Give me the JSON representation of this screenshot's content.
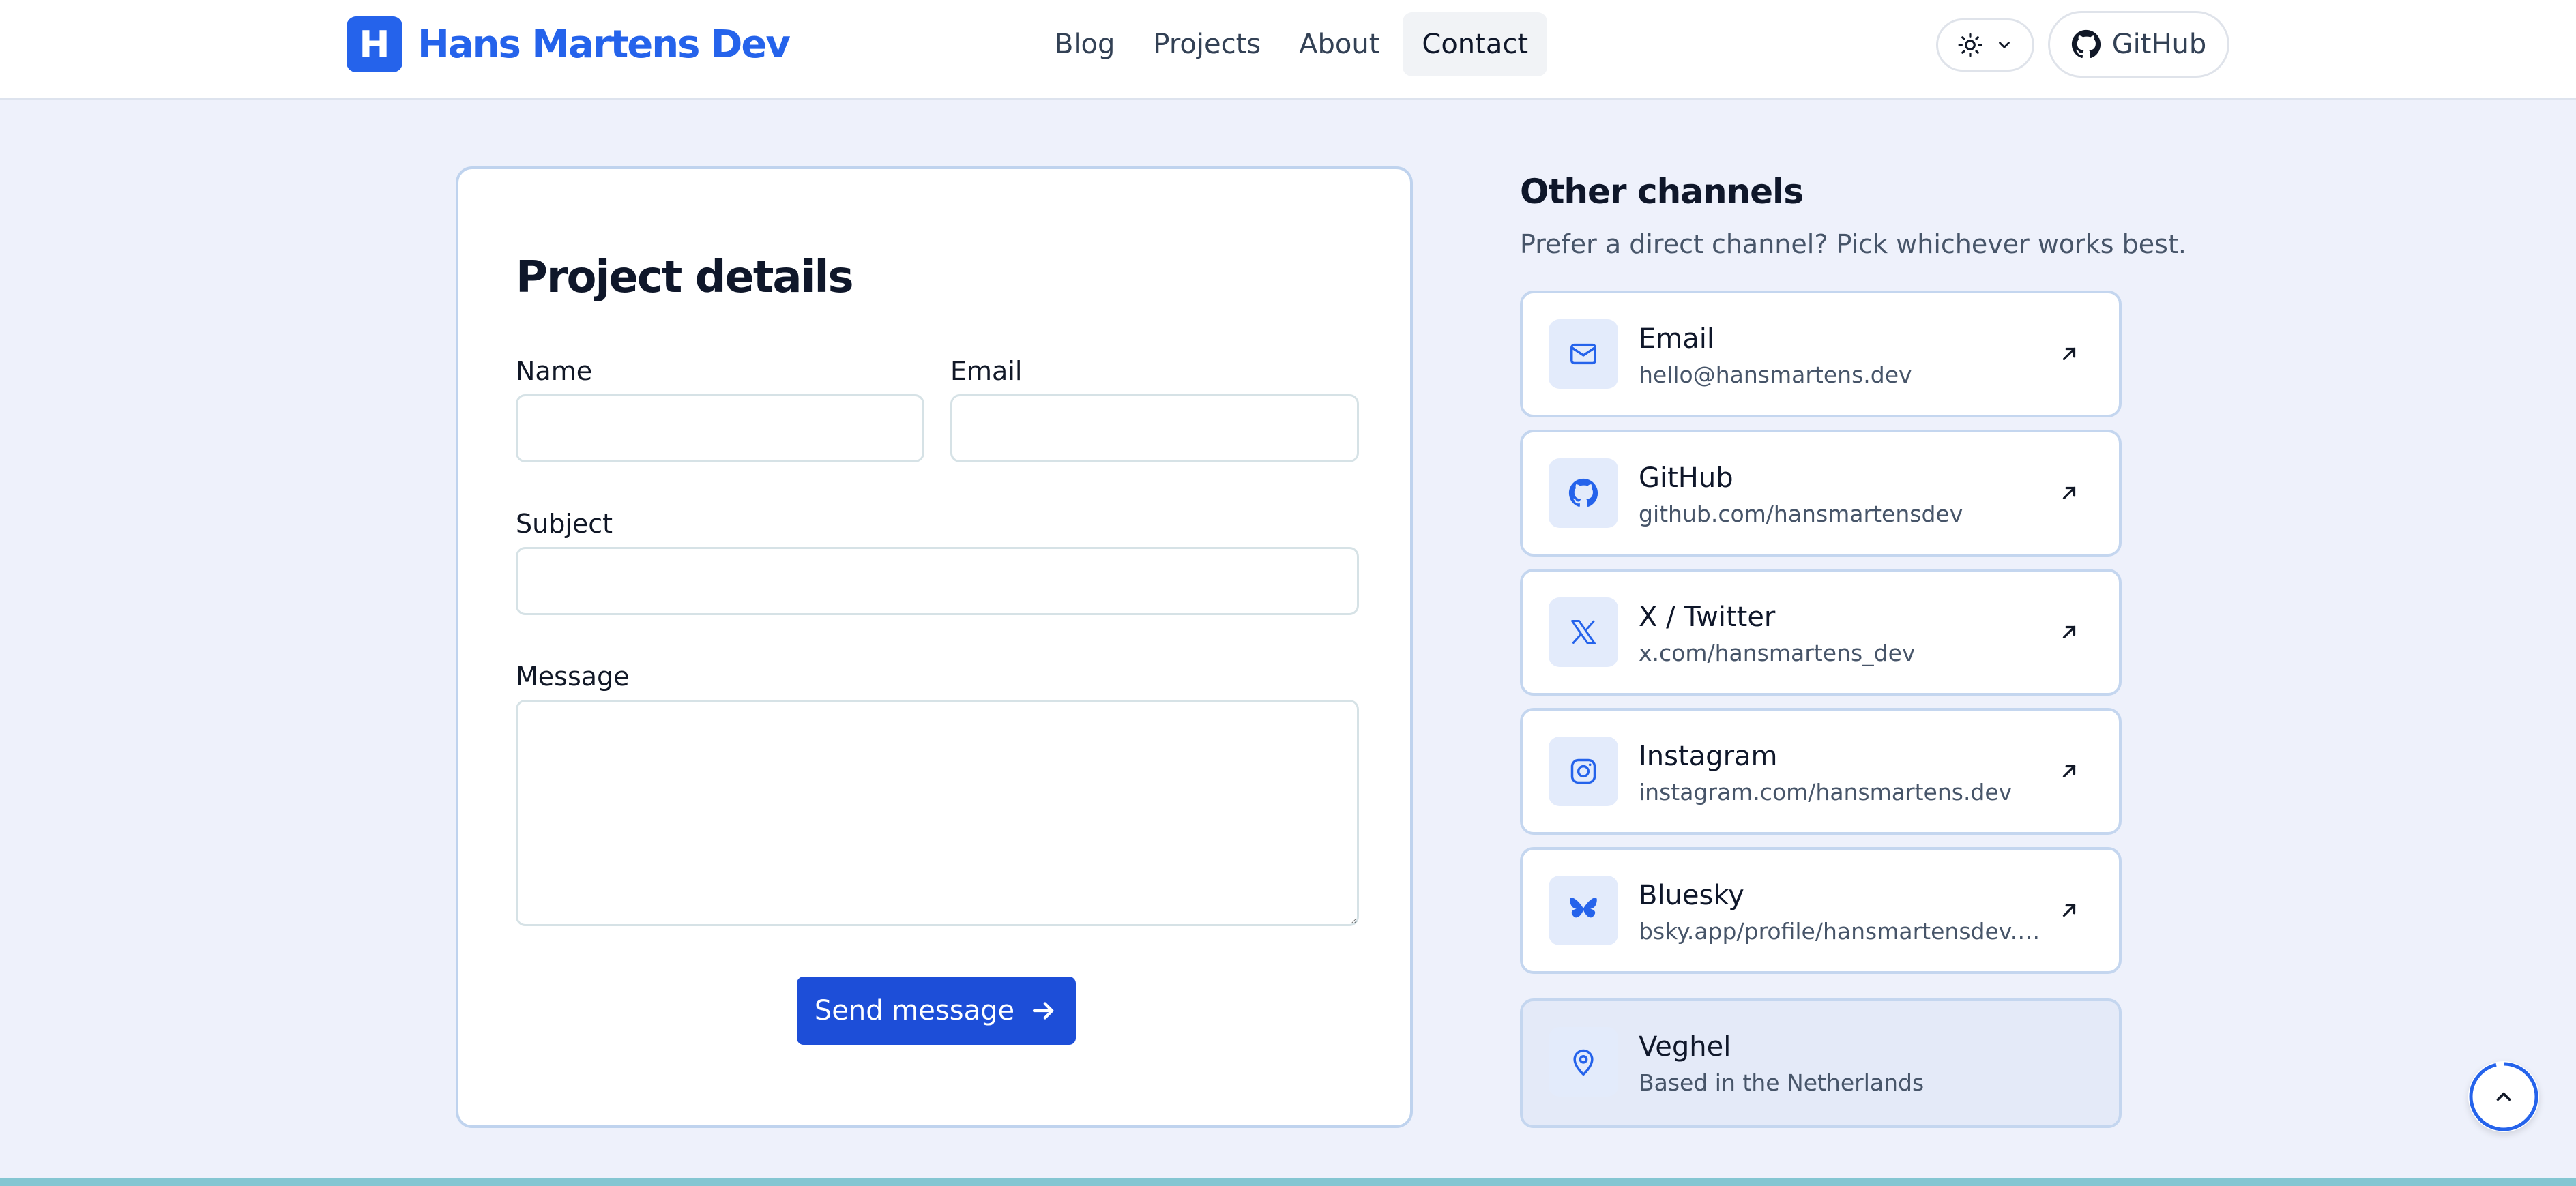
{
  "header": {
    "brand_initial": "H",
    "brand_name": "Hans Martens Dev",
    "nav": [
      {
        "label": "Blog"
      },
      {
        "label": "Projects"
      },
      {
        "label": "About"
      },
      {
        "label": "Contact"
      }
    ],
    "active_nav": "Contact",
    "theme_toggle_icon": "sun-icon",
    "github_label": "GitHub"
  },
  "form": {
    "title": "Project details",
    "name_label": "Name",
    "email_label": "Email",
    "subject_label": "Subject",
    "message_label": "Message",
    "name_value": "",
    "email_value": "",
    "subject_value": "",
    "message_value": "",
    "submit_label": "Send message"
  },
  "side": {
    "title": "Other channels",
    "subtitle": "Prefer a direct channel? Pick whichever works best.",
    "channels": [
      {
        "name": "Email",
        "value": "hello@hansmartens.dev",
        "icon": "mail-icon"
      },
      {
        "name": "GitHub",
        "value": "github.com/hansmartensdev",
        "icon": "github-icon"
      },
      {
        "name": "X / Twitter",
        "value": "x.com/hansmartens_dev",
        "icon": "x-icon"
      },
      {
        "name": "Instagram",
        "value": "instagram.com/hansmartens.dev",
        "icon": "instagram-icon"
      },
      {
        "name": "Bluesky",
        "value": "bsky.app/profile/hansmartensdev.bsky.social",
        "icon": "butterfly-icon"
      }
    ],
    "location": {
      "name": "Veghel",
      "value": "Based in the Netherlands",
      "icon": "map-pin-icon"
    }
  },
  "colors": {
    "accent": "#2563eb",
    "page_bg": "#eef1fb",
    "card_border": "#bfd3ee",
    "bottom_bar": "#84c6d2"
  }
}
